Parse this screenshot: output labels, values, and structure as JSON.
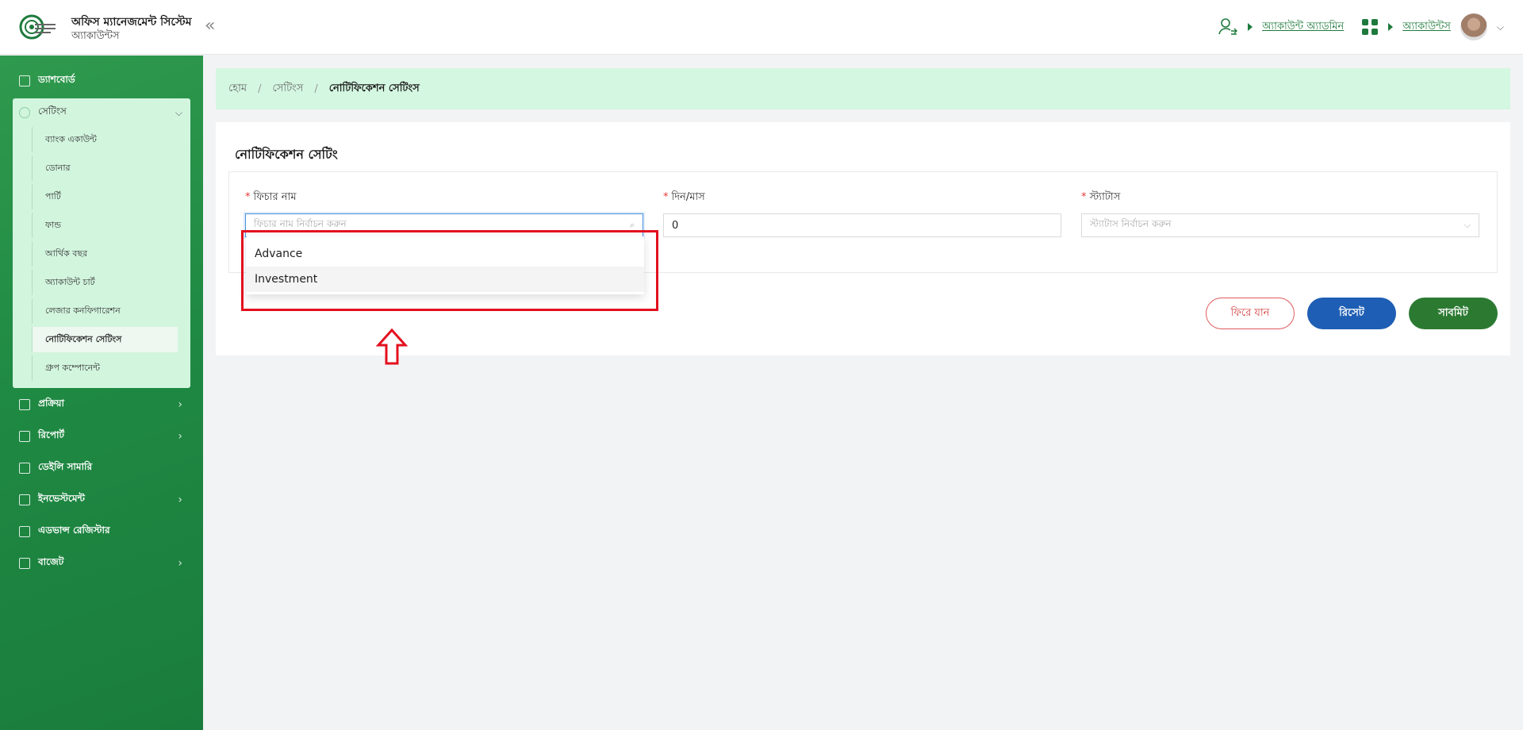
{
  "header": {
    "app_title": "অফিস ম্যানেজমেন্ট সিস্টেম",
    "app_subtitle": "অ্যাকাউন্টস",
    "collapse_icon": "«",
    "account_admin_link": "অ্যাকাউন্ট অ্যাডমিন",
    "accounts_link": "অ্যাকাউন্টস"
  },
  "sidebar": {
    "dashboard": "ড্যাশবোর্ড",
    "settings": "সেটিংস",
    "settings_items": [
      "ব্যাংক একাউন্ট",
      "ডোনার",
      "পার্টি",
      "ফান্ড",
      "আর্থিক বছর",
      "অ্যাকাউন্ট চার্ট",
      "লেজার কনফিগারেশন",
      "নোটিফিকেশন সেটিংস",
      "গ্রুপ কম্পোনেন্ট"
    ],
    "process": "প্রক্রিয়া",
    "report": "রিপোর্ট",
    "daily_summary": "ডেইলি সামারি",
    "investment": "ইনভেস্টমেন্ট",
    "advance_register": "এডভান্স রেজিস্টার",
    "budget": "বাজেট"
  },
  "breadcrumb": {
    "home": "হোম",
    "settings": "সেটিংস",
    "current": "নোটিফিকেশন সেটিংস",
    "sep": "/"
  },
  "form": {
    "title": "নোটিফিকেশন সেটিং",
    "required_mark": "*",
    "feature_label": "ফিচার নাম",
    "feature_placeholder": "ফিচার নাম নির্বাচন করুন",
    "days_label": "দিন/মাস",
    "days_value": "0",
    "status_label": "স্ট্যাটাস",
    "status_placeholder": "স্ট্যাটাস নির্বাচন করুন",
    "dropdown_options": [
      "Advance",
      "Investment"
    ]
  },
  "buttons": {
    "back": "ফিরে যান",
    "reset": "রিসেট",
    "submit": "সাবমিট"
  },
  "colors": {
    "primary_green": "#1f8a43",
    "reset_blue": "#1e5eb4",
    "submit_green": "#2c7a32",
    "highlight_red": "#e3101e"
  }
}
